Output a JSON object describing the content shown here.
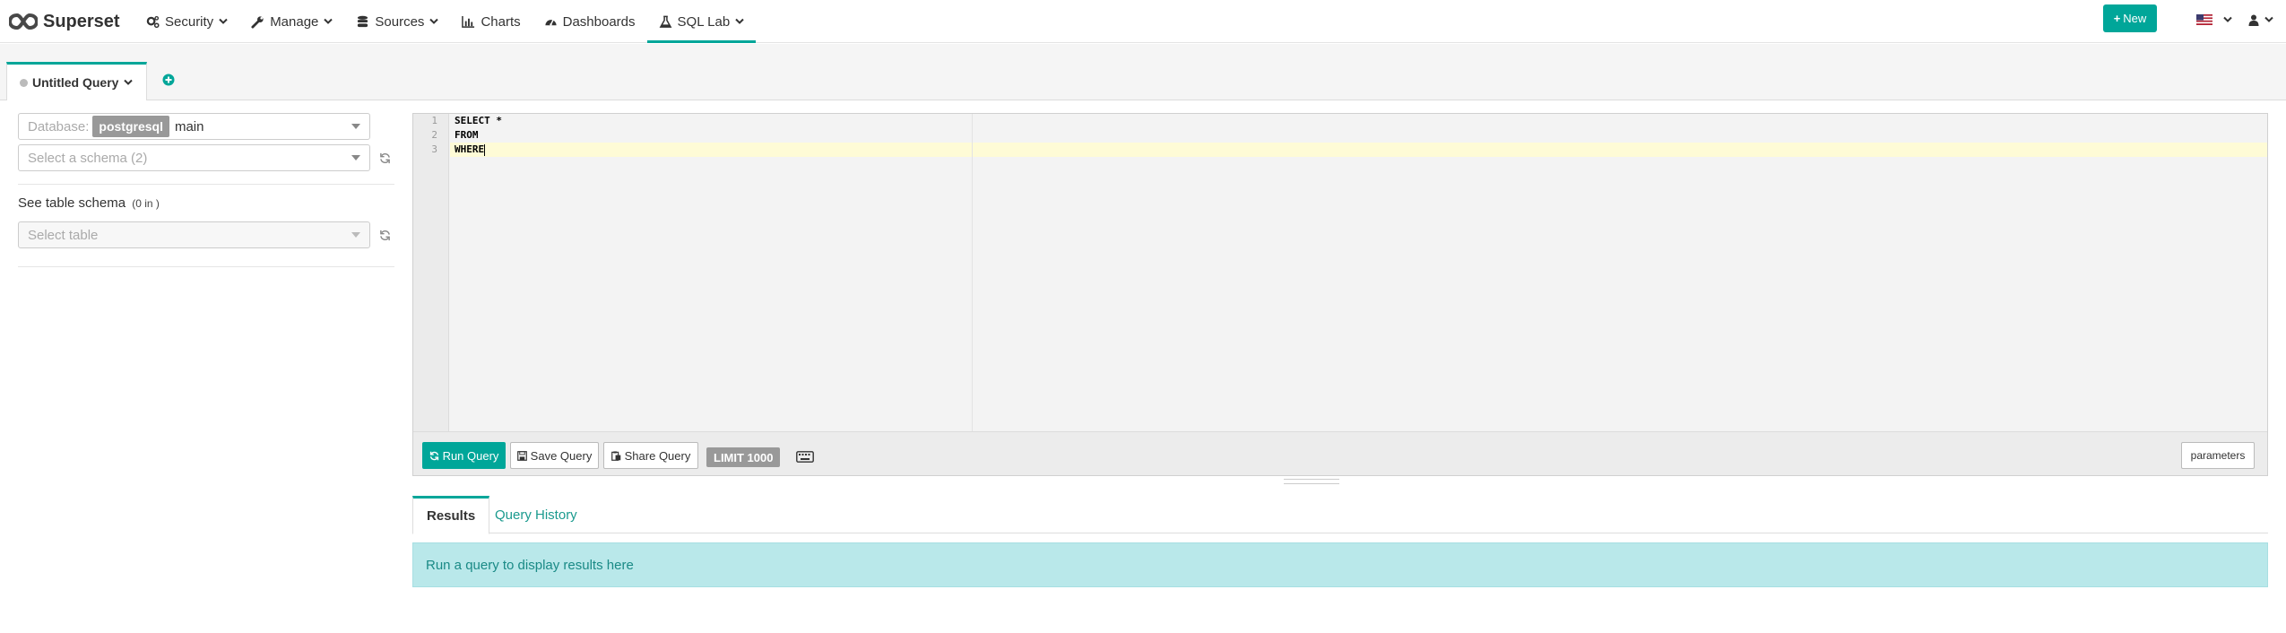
{
  "navbar": {
    "brand": "Superset",
    "items": [
      {
        "label": "Security",
        "icon": "cogs-icon",
        "dropdown": true
      },
      {
        "label": "Manage",
        "icon": "wrench-icon",
        "dropdown": true
      },
      {
        "label": "Sources",
        "icon": "database-icon",
        "dropdown": true
      },
      {
        "label": "Charts",
        "icon": "bar-chart-icon",
        "dropdown": false
      },
      {
        "label": "Dashboards",
        "icon": "dashboard-icon",
        "dropdown": false
      },
      {
        "label": "SQL Lab",
        "icon": "flask-icon",
        "dropdown": true,
        "active": true
      }
    ],
    "new_button": "New",
    "language_icon": "us-flag-icon",
    "user_icon": "user-icon"
  },
  "query_tabs": {
    "tabs": [
      {
        "label": "Untitled Query",
        "status": "offline"
      }
    ],
    "add_icon": "plus-circle-icon"
  },
  "left_panel": {
    "database": {
      "label": "Database:",
      "backend": "postgresql",
      "name": "main"
    },
    "schema": {
      "placeholder": "Select a schema (2)"
    },
    "table_schema_title": "See table schema",
    "table_schema_count": "(0 in )",
    "table": {
      "placeholder": "Select table"
    }
  },
  "editor": {
    "lines": [
      "SELECT *",
      "FROM",
      "WHERE"
    ],
    "line_numbers": [
      "1",
      "2",
      "3"
    ],
    "active_line": 3
  },
  "toolbar": {
    "run_label": "Run Query",
    "save_label": "Save Query",
    "share_label": "Share Query",
    "limit_label": "LIMIT 1000",
    "parameters_label": "parameters"
  },
  "results": {
    "tabs": [
      "Results",
      "Query History"
    ],
    "message": "Run a query to display results here"
  },
  "colors": {
    "primary": "#00a699",
    "info_bg": "#b9e8ea",
    "info_text": "#1a8a86",
    "active_line": "#fefbd6"
  }
}
